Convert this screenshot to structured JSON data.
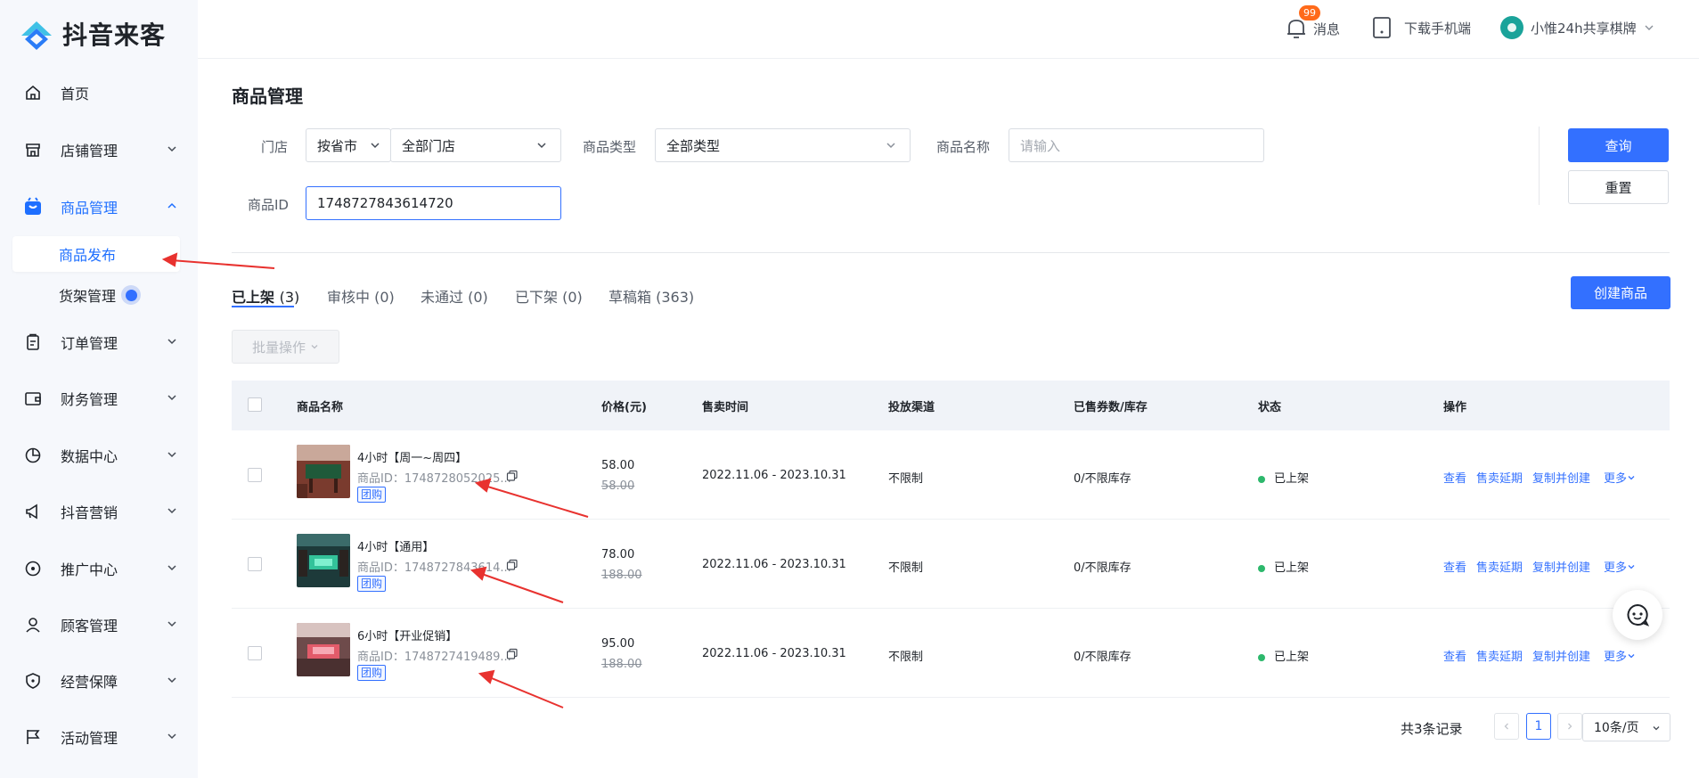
{
  "app": {
    "name": "抖音来客"
  },
  "header": {
    "messages_label": "消息",
    "messages_badge": "99",
    "download_label": "下载手机端",
    "user_name": "小惟24h共享棋牌"
  },
  "sidebar": {
    "items": [
      {
        "label": "首页",
        "icon": "home-icon"
      },
      {
        "label": "店铺管理",
        "icon": "store-icon"
      },
      {
        "label": "商品管理",
        "icon": "goods-icon"
      },
      {
        "label": "订单管理",
        "icon": "order-icon"
      },
      {
        "label": "财务管理",
        "icon": "wallet-icon"
      },
      {
        "label": "数据中心",
        "icon": "pie-chart-icon"
      },
      {
        "label": "抖音营销",
        "icon": "megaphone-icon"
      },
      {
        "label": "推广中心",
        "icon": "location-pin-icon"
      },
      {
        "label": "顾客管理",
        "icon": "user-icon"
      },
      {
        "label": "经营保障",
        "icon": "shield-icon"
      },
      {
        "label": "活动管理",
        "icon": "flag-icon"
      }
    ],
    "sub_items": [
      {
        "label": "商品发布"
      },
      {
        "label": "货架管理"
      }
    ]
  },
  "page": {
    "title": "商品管理"
  },
  "filters": {
    "store_label": "门店",
    "store_scope": "按省市",
    "store_value": "全部门店",
    "type_label": "商品类型",
    "type_value": "全部类型",
    "name_label": "商品名称",
    "name_placeholder": "请输入",
    "id_label": "商品ID",
    "id_value": "1748727843614720",
    "query_button": "查询",
    "reset_button": "重置"
  },
  "tabs": [
    {
      "label": "已上架",
      "count": "(3)"
    },
    {
      "label": "审核中",
      "count": "(0)"
    },
    {
      "label": "未通过",
      "count": "(0)"
    },
    {
      "label": "已下架",
      "count": "(0)"
    },
    {
      "label": "草稿箱",
      "count": "(363)"
    }
  ],
  "actions": {
    "create_button": "创建商品",
    "batch_button": "批量操作"
  },
  "table": {
    "columns": [
      "商品名称",
      "价格(元)",
      "售卖时间",
      "投放渠道",
      "已售券数/库存",
      "状态",
      "操作"
    ],
    "rows": [
      {
        "name": "4小时【周一~周四】",
        "id_text": "商品ID：1748728052025...",
        "tag": "团购",
        "price": "58.00",
        "price_orig": "58.00",
        "time": "2022.11.06 - 2023.10.31",
        "channel": "不限制",
        "stock": "0/不限库存",
        "status": "已上架"
      },
      {
        "name": "4小时【通用】",
        "id_text": "商品ID：1748727843614...",
        "tag": "团购",
        "price": "78.00",
        "price_orig": "188.00",
        "time": "2022.11.06 - 2023.10.31",
        "channel": "不限制",
        "stock": "0/不限库存",
        "status": "已上架"
      },
      {
        "name": "6小时【开业促销】",
        "id_text": "商品ID：1748727419489...",
        "tag": "团购",
        "price": "95.00",
        "price_orig": "188.00",
        "time": "2022.11.06 - 2023.10.31",
        "channel": "不限制",
        "stock": "0/不限库存",
        "status": "已上架"
      }
    ],
    "ops": {
      "view": "查看",
      "extend": "售卖延期",
      "copy": "复制并创建",
      "more": "更多"
    }
  },
  "pagination": {
    "total_text": "共3条记录",
    "current_page": "1",
    "page_size": "10条/页"
  },
  "colors": {
    "primary": "#3370ff",
    "status_green": "#2db86c",
    "annotation_red": "#e8322f"
  }
}
